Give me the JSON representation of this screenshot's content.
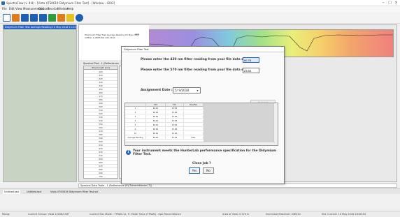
{
  "window": {
    "title": "SpectraFlow (v. 4.8) - [Vista VTS0619 Didymium Filter Test] - [Window - 4202]",
    "minimize_glyph": "–",
    "maximize_glyph": "□",
    "close_glyph": "×"
  },
  "menu": [
    "File",
    "Edit",
    "View",
    "Measurements",
    "Options",
    "Service",
    "Window",
    "Help"
  ],
  "toolbar": {
    "icons": [
      "new-icon",
      "open-icon",
      "save-icon",
      "save-all-icon",
      "print-icon",
      "measure-icon",
      "export-icon",
      "settings-icon",
      "help-icon"
    ]
  },
  "left_panel": {
    "title": "Didymium Filter Test Average Reading 10 May 2018 11:10"
  },
  "chart_header": {
    "title": "Didymium Filter Test Average Reading 10 May 2018",
    "subtitle": "Avfilter 1 (NIST#2) 190-1100",
    "y_top": "100",
    "y_bottom": "0"
  },
  "spectral_plot": {
    "title": "Spectral Plot - 1 (Reflectance",
    "wl_header": "Wavelength [nm]",
    "wavelengths": [
      "400",
      "410",
      "420",
      "430",
      "440",
      "450",
      "460",
      "470",
      "480",
      "490",
      "500",
      "510",
      "520",
      "530",
      "540",
      "550",
      "560",
      "570",
      "580",
      "590",
      "600",
      "610",
      "620",
      "630",
      "640",
      "650",
      "660",
      "670",
      "680",
      "690",
      "700"
    ],
    "values": [
      "80.46",
      "70.22",
      "83.76",
      "80.11"
    ]
  },
  "dialog": {
    "title": "Didymium Filter Test",
    "prompt_430": "Please enter the 430 nm filter reading from your file data sheet",
    "value_430": "60.78",
    "prompt_570": "Please enter the 570 nm filter reading from your file data sheet",
    "value_570": "23.65",
    "assignment_label": "Assignment Date :",
    "assignment_date": "5/ 9/2018",
    "accept_label": "Accept",
    "grid_headers": [
      "",
      "430",
      "570",
      "Pass/Fail"
    ],
    "grid_rows": [
      [
        "1",
        "60.60",
        "23.68",
        ""
      ],
      [
        "2",
        "60.60",
        "23.68",
        ""
      ],
      [
        "3",
        "60.60",
        "23.68",
        ""
      ],
      [
        "4",
        "60.60",
        "23.68",
        ""
      ],
      [
        "5",
        "60.60",
        "23.68",
        ""
      ],
      [
        "6",
        "60.60",
        "23.68",
        ""
      ],
      [
        "10",
        "60.60",
        "23.68",
        ""
      ],
      [
        "Average Reading",
        "60.60",
        "23.68",
        "Pass"
      ]
    ],
    "message": "Your instrument meets the HunterLab performance specification for the Didymium Filter Test.",
    "close_job": "Close Job ?",
    "yes_label": "Yes",
    "no_label": "No"
  },
  "bottom_data_title": "Spectral Data Table - 1 (Reflectance (R)/Transmittance (T))",
  "tabs": [
    "Untitled.ssd",
    "Untitled.ssd",
    "Vista VTS0619 Didymium Filter Test.ssf"
  ],
  "status": {
    "ready": "Ready",
    "sensor": "Current Sensor: Vista 12006/1187",
    "mode": "Current Std. Mode : TTRAN-12, Tr. Mode Trans (TTRAN) - Spe-Transmittance",
    "area": "Area of View: 0.375 in",
    "illum": "Illuminant/Observer: D65/10",
    "date": "Std. Current: 10 May 2018 18:08:54"
  },
  "colors": {
    "accent": "#2a63c2",
    "panel_bg": "#c9d3c3"
  }
}
